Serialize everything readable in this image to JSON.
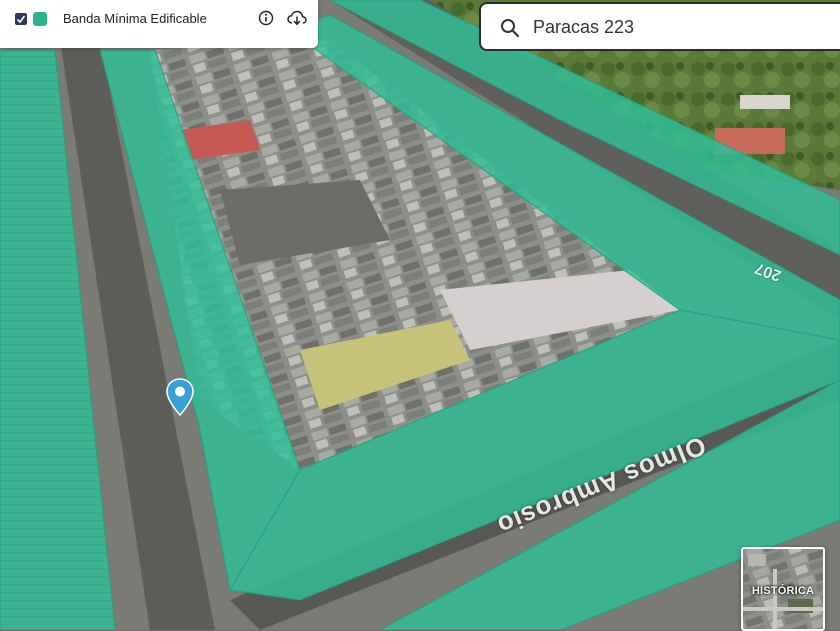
{
  "layer_panel": {
    "checked": true,
    "swatch_color": "#2fb38f",
    "name": "Banda Mínima Edificable",
    "info_icon": "info-icon",
    "download_icon": "cloud-download-icon"
  },
  "search": {
    "value": "Paracas 223",
    "icon": "search-icon"
  },
  "map": {
    "overlay_color": "#2fbf98",
    "street_label": "Olmos Ambrosio",
    "street_number": "207",
    "pin_icon": "location-pin-icon"
  },
  "basemap_toggle": {
    "label": "HISTÓRICA"
  }
}
